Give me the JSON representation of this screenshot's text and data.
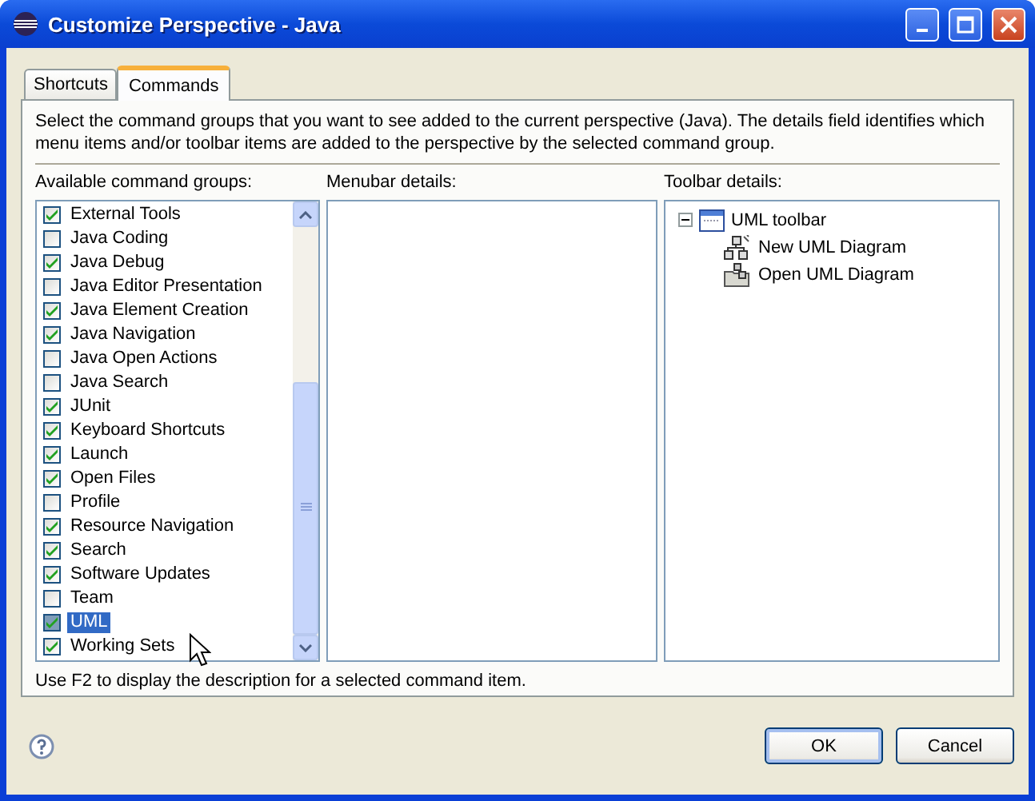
{
  "window": {
    "title": "Customize Perspective - Java"
  },
  "tabs": [
    {
      "label": "Shortcuts",
      "selected": false
    },
    {
      "label": "Commands",
      "selected": true
    }
  ],
  "description": "Select the command groups that you want to see added to the current perspective (Java).  The details field identifies which menu items and/or toolbar items are added to the perspective by the selected command group.",
  "command_groups": {
    "label": "Available command groups:",
    "items": [
      {
        "label": "External Tools",
        "checked": true,
        "selected": false
      },
      {
        "label": "Java Coding",
        "checked": false,
        "selected": false
      },
      {
        "label": "Java Debug",
        "checked": true,
        "selected": false
      },
      {
        "label": "Java Editor Presentation",
        "checked": false,
        "selected": false
      },
      {
        "label": "Java Element Creation",
        "checked": true,
        "selected": false
      },
      {
        "label": "Java Navigation",
        "checked": true,
        "selected": false
      },
      {
        "label": "Java Open Actions",
        "checked": false,
        "selected": false
      },
      {
        "label": "Java Search",
        "checked": false,
        "selected": false
      },
      {
        "label": "JUnit",
        "checked": true,
        "selected": false
      },
      {
        "label": "Keyboard Shortcuts",
        "checked": true,
        "selected": false
      },
      {
        "label": "Launch",
        "checked": true,
        "selected": false
      },
      {
        "label": "Open Files",
        "checked": true,
        "selected": false
      },
      {
        "label": "Profile",
        "checked": false,
        "selected": false
      },
      {
        "label": "Resource Navigation",
        "checked": true,
        "selected": false
      },
      {
        "label": "Search",
        "checked": true,
        "selected": false
      },
      {
        "label": "Software Updates",
        "checked": true,
        "selected": false
      },
      {
        "label": "Team",
        "checked": false,
        "selected": false
      },
      {
        "label": "UML",
        "checked": true,
        "selected": true
      },
      {
        "label": "Working Sets",
        "checked": true,
        "selected": false
      }
    ]
  },
  "menubar_details": {
    "label": "Menubar details:"
  },
  "toolbar_details": {
    "label": "Toolbar details:",
    "tree": [
      {
        "label": "UML toolbar",
        "kind": "toolbar",
        "expanded": true,
        "children": [
          {
            "label": "New UML Diagram",
            "kind": "new"
          },
          {
            "label": "Open UML Diagram",
            "kind": "open"
          }
        ]
      }
    ]
  },
  "hint": "Use F2 to display the description for a selected command item.",
  "buttons": [
    "OK",
    "Cancel"
  ]
}
